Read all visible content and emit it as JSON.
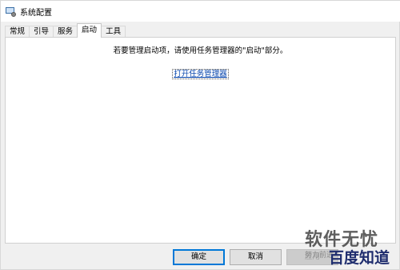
{
  "window": {
    "title": "系统配置"
  },
  "tabs": [
    {
      "label": "常规",
      "active": false
    },
    {
      "label": "引导",
      "active": false
    },
    {
      "label": "服务",
      "active": false
    },
    {
      "label": "启动",
      "active": true
    },
    {
      "label": "工具",
      "active": false
    }
  ],
  "panel": {
    "message": "若要管理启动项，请使用任务管理器的\"启动\"部分。",
    "link": "打开任务管理器"
  },
  "buttons": {
    "ok": "确定",
    "cancel": "取消",
    "apply": "应用"
  },
  "watermark": {
    "line1": "软件无忧",
    "line2": "努力前进",
    "line3": "百度知道"
  },
  "colors": {
    "link": "#0645ad",
    "primary_border": "#0078d7"
  }
}
